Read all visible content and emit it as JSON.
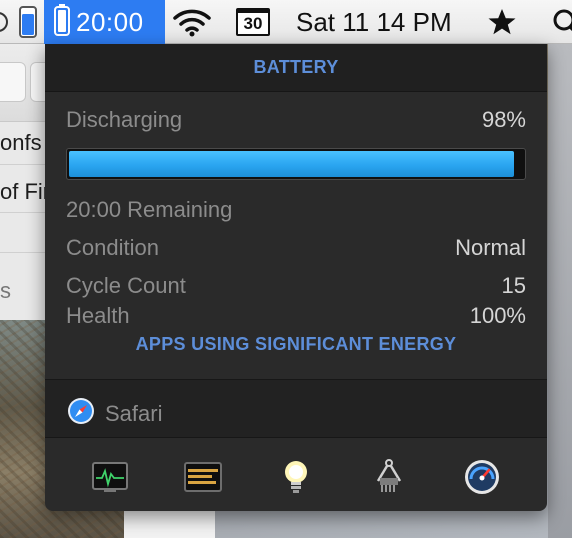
{
  "menubar": {
    "battery_time": "20:00",
    "calendar_day": "30",
    "datetime": "Sat 11 14 PM",
    "icons": [
      "left-partial-icon",
      "battery-level-icon",
      "battery-icon",
      "wifi-icon",
      "calendar-icon",
      "star-icon",
      "search-icon"
    ]
  },
  "background_window": {
    "text_1": "onfs",
    "text_2": "of Fin",
    "text_3": "s"
  },
  "panel": {
    "title": "BATTERY",
    "status": {
      "label": "Discharging",
      "percent": "98%"
    },
    "charge_fraction": 0.98,
    "remaining": "20:00 Remaining",
    "stats": [
      {
        "label": "Condition",
        "value": "Normal"
      },
      {
        "label": "Cycle Count",
        "value": "15"
      },
      {
        "label": "Health",
        "value": "100%"
      }
    ],
    "apps_title": "APPS USING SIGNIFICANT ENERGY",
    "apps": [
      {
        "name": "Safari",
        "icon": "safari-icon"
      }
    ],
    "toolbar": [
      "activity-monitor-icon",
      "console-icon",
      "lightbulb-icon",
      "system-information-icon",
      "disk-utility-icon"
    ],
    "colors": {
      "accent": "#5d8ed9",
      "bar": "#2aa5f0",
      "selected": "#2d7cf2"
    }
  }
}
